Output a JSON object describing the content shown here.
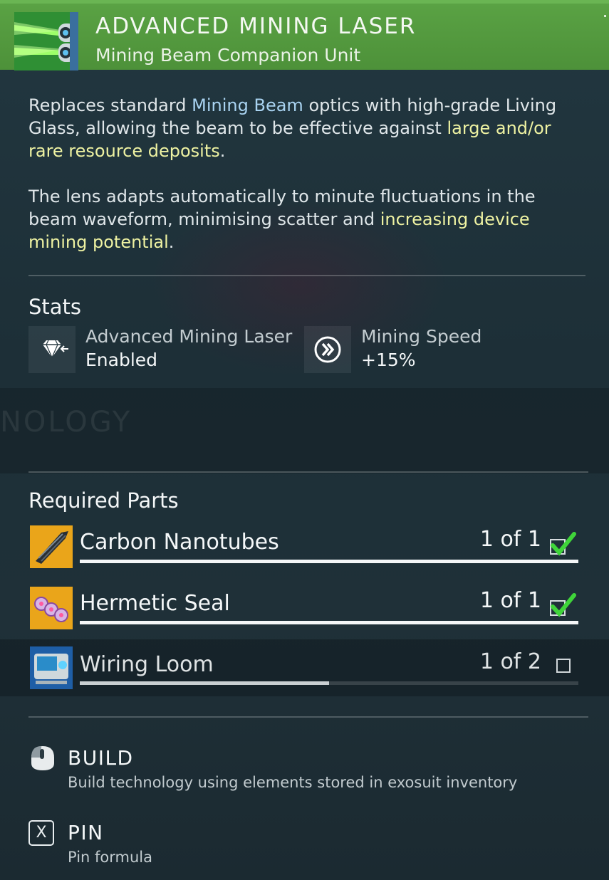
{
  "header": {
    "title": "ADVANCED MINING LASER",
    "subtitle": "Mining Beam Companion Unit",
    "icon": "mining-laser-icon",
    "color": "#5aa244"
  },
  "description": {
    "p1": {
      "t1": "Replaces standard ",
      "hl1": "Mining Beam",
      "t2": " optics with high-grade Living Glass, allowing the beam to be effective against ",
      "hl2": "large and/or rare resource deposits",
      "t3": "."
    },
    "p2": {
      "t1": "The lens adapts automatically to minute fluctuations in the beam waveform, minimising scatter and ",
      "hl1": "increasing device mining potential",
      "t2": "."
    }
  },
  "stats": {
    "title": "Stats",
    "items": [
      {
        "label": "Advanced Mining Laser",
        "value": "Enabled",
        "icon": "diamond-icon"
      },
      {
        "label": "Mining Speed",
        "value": "+15%",
        "icon": "fast-forward-circle-icon"
      }
    ]
  },
  "parts": {
    "title": "Required Parts",
    "items": [
      {
        "name": "Carbon Nanotubes",
        "count": "1 of 1",
        "progress": 1.0,
        "complete": true,
        "icon": "carbon-nanotubes-icon"
      },
      {
        "name": "Hermetic Seal",
        "count": "1 of 1",
        "progress": 1.0,
        "complete": true,
        "icon": "hermetic-seal-icon"
      },
      {
        "name": "Wiring Loom",
        "count": "1 of 2",
        "progress": 0.5,
        "complete": false,
        "icon": "wiring-loom-icon"
      }
    ]
  },
  "actions": {
    "build": {
      "label": "BUILD",
      "description": "Build technology using elements stored in exosuit inventory",
      "icon": "mouse-left-click-icon"
    },
    "pin": {
      "label": "PIN",
      "description": "Pin formula",
      "key": "X"
    }
  },
  "colors": {
    "highlight_blue": "#a9d3f1",
    "highlight_yellow": "#eef2a2",
    "check_green": "#3fd43a"
  }
}
